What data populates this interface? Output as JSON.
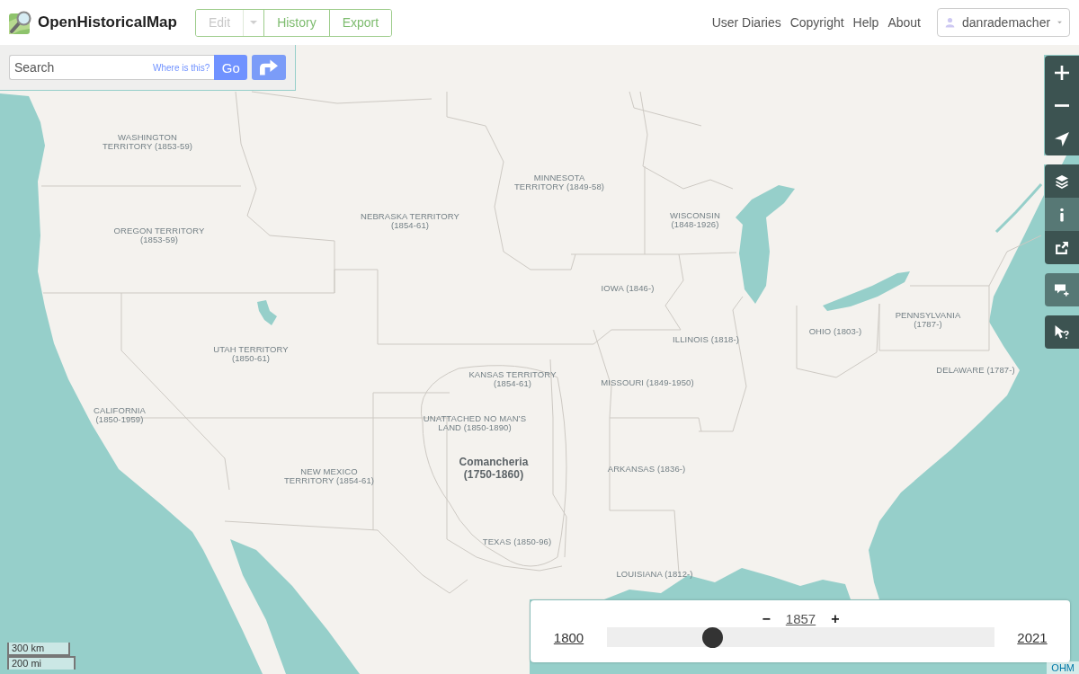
{
  "header": {
    "logo": "OpenHistoricalMap",
    "edit_menu": [
      {
        "kind": "button",
        "label": "Edit",
        "disabled": true
      },
      {
        "kind": "dropdown",
        "disabled": true
      },
      {
        "kind": "button",
        "label": "History",
        "disabled": false
      },
      {
        "kind": "button",
        "label": "Export",
        "disabled": false
      }
    ],
    "nav_links": [
      "User Diaries",
      "Copyright",
      "Help",
      "About"
    ],
    "user": {
      "name": "danrademacher"
    }
  },
  "search": {
    "placeholder": "Search",
    "hint_link": "Where is this?",
    "submit": "Go"
  },
  "map_labels": [
    {
      "kind": "territory",
      "lines": [
        "WASHINGTON",
        "TERRITORY (1853-59)"
      ]
    },
    {
      "kind": "territory",
      "lines": [
        "MINNESOTA",
        "TERRITORY (1849-58)"
      ]
    },
    {
      "kind": "territory",
      "lines": [
        "NEBRASKA TERRITORY",
        "(1854-61)"
      ]
    },
    {
      "kind": "territory",
      "lines": [
        "WISCONSIN",
        "(1848-1926)"
      ]
    },
    {
      "kind": "territory",
      "lines": [
        "OREGON TERRITORY",
        "(1853-59)"
      ]
    },
    {
      "kind": "territory",
      "lines": [
        "IOWA (1846-)"
      ]
    },
    {
      "kind": "territory",
      "lines": [
        "PENNSYLVANIA",
        "(1787-)"
      ]
    },
    {
      "kind": "territory",
      "lines": [
        "OHIO (1803-)"
      ]
    },
    {
      "kind": "territory",
      "lines": [
        "ILLINOIS (1818-)"
      ]
    },
    {
      "kind": "territory",
      "lines": [
        "UTAH TERRITORY",
        "(1850-61)"
      ]
    },
    {
      "kind": "territory",
      "lines": [
        "DELAWARE (1787-)"
      ]
    },
    {
      "kind": "territory",
      "lines": [
        "KANSAS TERRITORY",
        "(1854-61)"
      ]
    },
    {
      "kind": "territory",
      "lines": [
        "MISSOURI (1849-1950)"
      ]
    },
    {
      "kind": "territory",
      "lines": [
        "CALIFORNIA",
        "(1850-1959)"
      ]
    },
    {
      "kind": "territory",
      "lines": [
        "UNATTACHED NO MAN’S",
        "LAND (1850-1890)"
      ]
    },
    {
      "kind": "region",
      "lines": [
        "Comancheria",
        "(1750-1860)"
      ]
    },
    {
      "kind": "territory",
      "lines": [
        "ARKANSAS (1836-)"
      ]
    },
    {
      "kind": "territory",
      "lines": [
        "NEW MEXICO",
        "TERRITORY (1854-61)"
      ]
    },
    {
      "kind": "territory",
      "lines": [
        "TEXAS (1850-96)"
      ]
    },
    {
      "kind": "territory",
      "lines": [
        "LOUISIANA (1812-)"
      ]
    }
  ],
  "map_controls": [
    {
      "buttons": [
        {
          "kind": "zoom_in",
          "disabled": false
        },
        {
          "kind": "zoom_out",
          "disabled": false
        },
        {
          "kind": "locate",
          "disabled": false
        }
      ]
    },
    {
      "buttons": [
        {
          "kind": "layers",
          "disabled": false
        },
        {
          "kind": "map_key",
          "disabled": true
        },
        {
          "kind": "share",
          "disabled": false
        }
      ]
    },
    {
      "buttons": [
        {
          "kind": "add_note",
          "disabled": true
        }
      ]
    },
    {
      "buttons": [
        {
          "kind": "query",
          "disabled": false
        }
      ]
    }
  ],
  "time_slider": {
    "decrement": "−",
    "current": "1857",
    "increment": "+",
    "start": "1800",
    "end": "2021",
    "level": 0.26
  },
  "scale": [
    "300 km",
    "200 mi"
  ],
  "attribution": "OHM"
}
